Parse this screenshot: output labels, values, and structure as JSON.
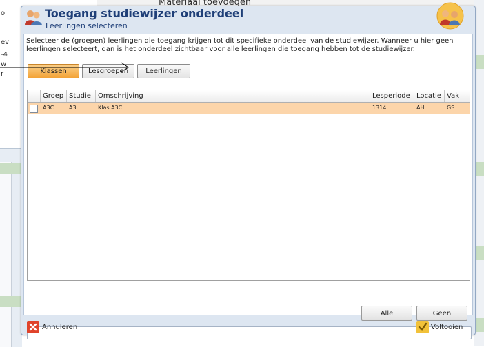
{
  "background": {
    "behind_title": "Materiaal toevoegen",
    "left_fragments": [
      "ol",
      "ev",
      "-4",
      "w",
      "r"
    ]
  },
  "dialog": {
    "title": "Toegang studiewijzer onderdeel",
    "subtitle": "Leerlingen selecteren",
    "intro": "Selecteer de (groepen) leerlingen die toegang krijgen tot dit specifieke onderdeel van de studiewijzer. Wanneer u hier geen leerlingen selecteert, dan is het onderdeel zichtbaar voor alle leerlingen die toegang hebben tot de studiewijzer.",
    "tabs": [
      {
        "label": "Klassen",
        "active": true
      },
      {
        "label": "Lesgroepen",
        "active": false
      },
      {
        "label": "Leerlingen",
        "active": false
      }
    ],
    "grid": {
      "columns": [
        "Groep",
        "Studie",
        "Omschrijving",
        "Lesperiode",
        "Locatie",
        "Vak"
      ],
      "rows": [
        {
          "checked": false,
          "cells": [
            "A3C",
            "A3",
            "Klas A3C",
            "1314",
            "AH",
            "GS"
          ]
        }
      ]
    },
    "all_label": "Alle",
    "none_label": "Geen",
    "status_value": "",
    "cancel_label": "Annuleren",
    "finish_label": "Voltooien"
  },
  "colors": {
    "title": "#1f3f78",
    "active_tab": "#f3a337",
    "selected_row": "#fcd5aa",
    "cancel": "#e0432b",
    "finish": "#f2c23a"
  }
}
